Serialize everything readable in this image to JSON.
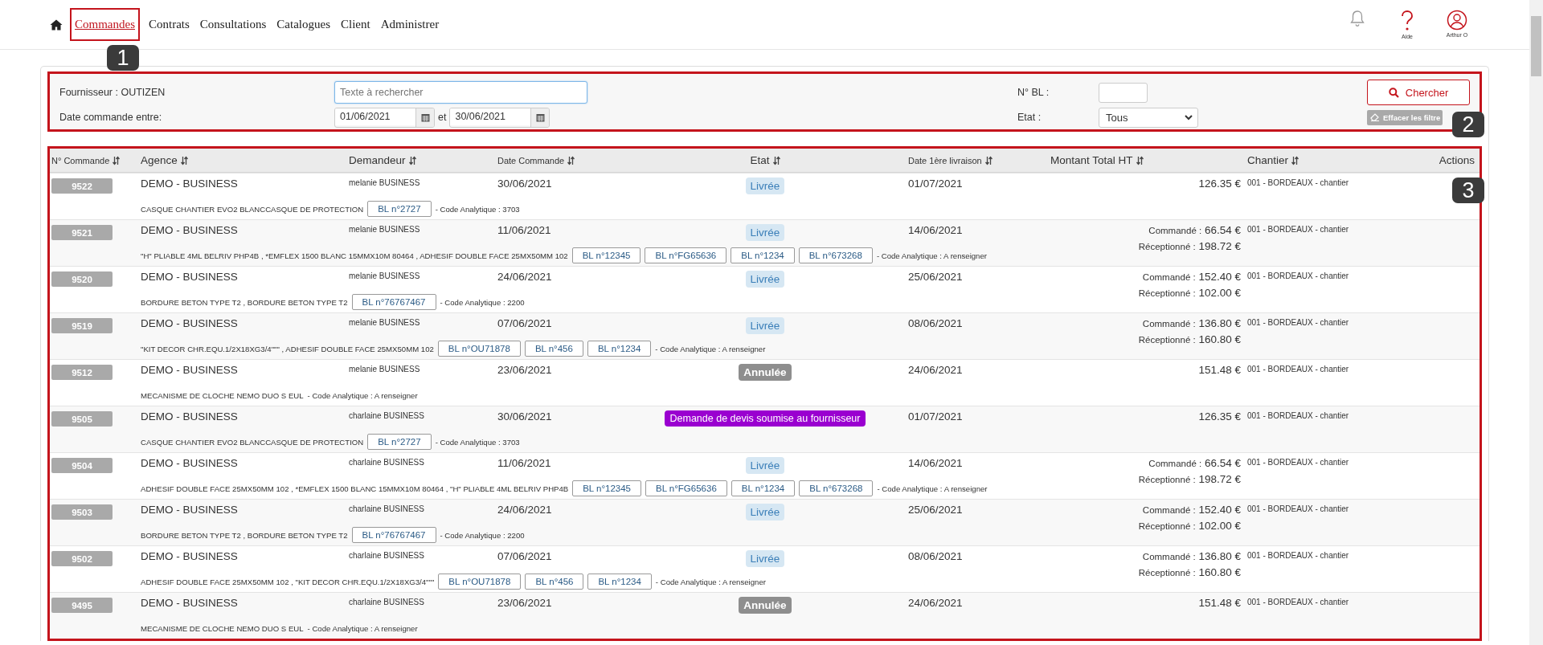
{
  "nav": {
    "items": [
      {
        "label": "Commandes",
        "selected": true
      },
      {
        "label": "Contrats",
        "selected": false
      },
      {
        "label": "Consultations",
        "selected": false
      },
      {
        "label": "Catalogues",
        "selected": false
      },
      {
        "label": "Client",
        "selected": false
      },
      {
        "label": "Administrer",
        "selected": false
      }
    ],
    "help_label": "Aide",
    "user_label": "Arthur O"
  },
  "filters": {
    "supplier_label": "Fournisseur : OUTIZEN",
    "search_placeholder": "Texte à rechercher",
    "date_label": "Date commande entre:",
    "date_from": "01/06/2021",
    "date_separator": "et",
    "date_to": "30/06/2021",
    "bl_label": "N° BL :",
    "state_label": "Etat :",
    "state_value": "Tous",
    "search_button": "Chercher",
    "clear_button": "Effacer les filtre"
  },
  "annotations": [
    {
      "label": "1"
    },
    {
      "label": "2"
    },
    {
      "label": "3"
    }
  ],
  "table": {
    "columns": [
      {
        "label": "N° Commande",
        "sortable": true
      },
      {
        "label": "Agence",
        "sortable": true
      },
      {
        "label": "Demandeur",
        "sortable": true
      },
      {
        "label": "Date Commande",
        "sortable": true
      },
      {
        "label": "Etat",
        "sortable": true
      },
      {
        "label": "Date 1ère livraison",
        "sortable": true
      },
      {
        "label": "Montant Total HT",
        "sortable": true
      },
      {
        "label": "Chantier",
        "sortable": true
      },
      {
        "label": "Actions",
        "sortable": false
      }
    ],
    "rows": [
      {
        "number": "9522",
        "agency": "DEMO - BUSINESS",
        "requester": "melanie BUSINESS",
        "date": "30/06/2021",
        "state": {
          "label": "Livrée",
          "kind": "delivered"
        },
        "delivery_date": "01/07/2021",
        "total": "126.35 €",
        "site": "001 - BORDEAUX - chantier",
        "products": "CASQUE CHANTIER EVO2 BLANCCASQUE DE PROTECTION",
        "bl": [
          "BL n°2727"
        ],
        "code": "- Code Analytique : 3703"
      },
      {
        "number": "9521",
        "agency": "DEMO - BUSINESS",
        "requester": "melanie BUSINESS",
        "date": "11/06/2021",
        "state": {
          "label": "Livrée",
          "kind": "delivered"
        },
        "delivery_date": "14/06/2021",
        "amounts": [
          {
            "label": "Commandé :",
            "value": "66.54 €"
          },
          {
            "label": "Réceptionné :",
            "value": "198.72 €"
          }
        ],
        "site": "001 - BORDEAUX - chantier",
        "products": "\"H\" PLIABLE 4ML BELRIV PHP4B , *EMFLEX 1500 BLANC 15MMX10M 80464 , ADHESIF DOUBLE FACE 25MX50MM 102",
        "bl": [
          "BL n°12345",
          "BL n°FG65636",
          "BL n°1234",
          "BL n°673268"
        ],
        "code": "- Code Analytique : A renseigner"
      },
      {
        "number": "9520",
        "agency": "DEMO - BUSINESS",
        "requester": "melanie BUSINESS",
        "date": "24/06/2021",
        "state": {
          "label": "Livrée",
          "kind": "delivered"
        },
        "delivery_date": "25/06/2021",
        "amounts": [
          {
            "label": "Commandé :",
            "value": "152.40 €"
          },
          {
            "label": "Réceptionné :",
            "value": "102.00 €"
          }
        ],
        "site": "001 - BORDEAUX - chantier",
        "products": "BORDURE BETON TYPE T2 , BORDURE BETON TYPE T2",
        "bl": [
          "BL n°76767467"
        ],
        "code": "- Code Analytique : 2200"
      },
      {
        "number": "9519",
        "agency": "DEMO - BUSINESS",
        "requester": "melanie BUSINESS",
        "date": "07/06/2021",
        "state": {
          "label": "Livrée",
          "kind": "delivered"
        },
        "delivery_date": "08/06/2021",
        "amounts": [
          {
            "label": "Commandé :",
            "value": "136.80 €"
          },
          {
            "label": "Réceptionné :",
            "value": "160.80 €"
          }
        ],
        "site": "001 - BORDEAUX - chantier",
        "products": "\"KIT DECOR CHR.EQU.1/2X18XG3/4\"\"\" , ADHESIF DOUBLE FACE 25MX50MM 102",
        "bl": [
          "BL n°OU71878",
          "BL n°456",
          "BL n°1234"
        ],
        "code": "- Code Analytique : A renseigner"
      },
      {
        "number": "9512",
        "agency": "DEMO - BUSINESS",
        "requester": "melanie BUSINESS",
        "date": "23/06/2021",
        "state": {
          "label": "Annulée",
          "kind": "cancelled"
        },
        "delivery_date": "24/06/2021",
        "total": "151.48 €",
        "site": "001 - BORDEAUX - chantier",
        "products": "MECANISME DE CLOCHE NEMO DUO S EUL",
        "code": "- Code Analytique : A renseigner"
      },
      {
        "number": "9505",
        "agency": "DEMO - BUSINESS",
        "requester": "charlaine BUSINESS",
        "date": "30/06/2021",
        "state": {
          "label": "Demande de devis soumise au fournisseur",
          "kind": "quote"
        },
        "delivery_date": "01/07/2021",
        "total": "126.35 €",
        "site": "001 - BORDEAUX - chantier",
        "products": "CASQUE CHANTIER EVO2 BLANCCASQUE DE PROTECTION",
        "bl": [
          "BL n°2727"
        ],
        "code": "- Code Analytique : 3703"
      },
      {
        "number": "9504",
        "agency": "DEMO - BUSINESS",
        "requester": "charlaine BUSINESS",
        "date": "11/06/2021",
        "state": {
          "label": "Livrée",
          "kind": "delivered"
        },
        "delivery_date": "14/06/2021",
        "amounts": [
          {
            "label": "Commandé :",
            "value": "66.54 €"
          },
          {
            "label": "Réceptionné :",
            "value": "198.72 €"
          }
        ],
        "site": "001 - BORDEAUX - chantier",
        "products": "ADHESIF DOUBLE FACE 25MX50MM 102 , *EMFLEX 1500 BLANC 15MMX10M 80464 , \"H\" PLIABLE 4ML BELRIV PHP4B",
        "bl": [
          "BL n°12345",
          "BL n°FG65636",
          "BL n°1234",
          "BL n°673268"
        ],
        "code": "- Code Analytique : A renseigner"
      },
      {
        "number": "9503",
        "agency": "DEMO - BUSINESS",
        "requester": "charlaine BUSINESS",
        "date": "24/06/2021",
        "state": {
          "label": "Livrée",
          "kind": "delivered"
        },
        "delivery_date": "25/06/2021",
        "amounts": [
          {
            "label": "Commandé :",
            "value": "152.40 €"
          },
          {
            "label": "Réceptionné :",
            "value": "102.00 €"
          }
        ],
        "site": "001 - BORDEAUX - chantier",
        "products": "BORDURE BETON TYPE T2 , BORDURE BETON TYPE T2",
        "bl": [
          "BL n°76767467"
        ],
        "code": "- Code Analytique : 2200"
      },
      {
        "number": "9502",
        "agency": "DEMO - BUSINESS",
        "requester": "charlaine BUSINESS",
        "date": "07/06/2021",
        "state": {
          "label": "Livrée",
          "kind": "delivered"
        },
        "delivery_date": "08/06/2021",
        "amounts": [
          {
            "label": "Commandé :",
            "value": "136.80 €"
          },
          {
            "label": "Réceptionné :",
            "value": "160.80 €"
          }
        ],
        "site": "001 - BORDEAUX - chantier",
        "products": "ADHESIF DOUBLE FACE 25MX50MM 102 , \"KIT DECOR CHR.EQU.1/2X18XG3/4\"\"\"",
        "bl": [
          "BL n°OU71878",
          "BL n°456",
          "BL n°1234"
        ],
        "code": "- Code Analytique : A renseigner"
      },
      {
        "number": "9495",
        "agency": "DEMO - BUSINESS",
        "requester": "charlaine BUSINESS",
        "date": "23/06/2021",
        "state": {
          "label": "Annulée",
          "kind": "cancelled"
        },
        "delivery_date": "24/06/2021",
        "total": "151.48 €",
        "site": "001 - BORDEAUX - chantier",
        "products": "MECANISME DE CLOCHE NEMO DUO S EUL",
        "code": "- Code Analytique : A renseigner"
      }
    ]
  }
}
